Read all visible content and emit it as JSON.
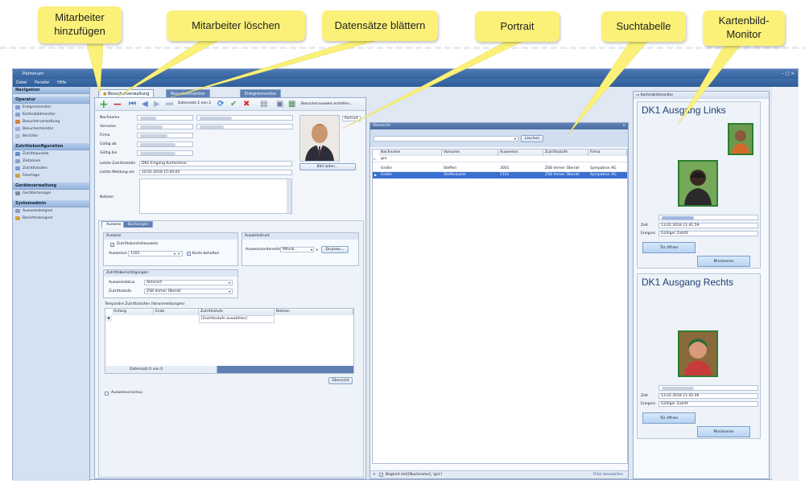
{
  "callouts": {
    "add": "Mitarbeiter hinzufügen",
    "delete": "Mitarbeiter löschen",
    "browse": "Datensätze blättern",
    "portrait": "Portrait",
    "search": "Suchtabelle",
    "monitor": "Kartenbild-Monitor"
  },
  "window": {
    "title": "Patronum",
    "menu": [
      "Datei",
      "Fenster",
      "Hilfe"
    ],
    "controls": "– □ ×"
  },
  "nav": {
    "header": "Navigation",
    "groups": [
      {
        "title": "Operator",
        "items": [
          "Ereignismonitor",
          "Kartenbildmonitor",
          "Besucherverwaltung",
          "Besuchermonitor",
          "Berichte"
        ]
      },
      {
        "title": "Zutrittskonfiguration",
        "items": [
          "Zutrittspunkte",
          "Zeitzonen",
          "Zutrittsstufen",
          "Feiertage"
        ]
      },
      {
        "title": "Geräteverwaltung",
        "items": [
          "Gerätemanager"
        ]
      },
      {
        "title": "Systemadmin",
        "items": [
          "Ausweisdesigner",
          "Berichtsdesigner"
        ]
      }
    ]
  },
  "tabs": [
    "Besucherverwaltung",
    "Besuchermonitor",
    "Ereignismonitor"
  ],
  "toolbar": {
    "record": "Datensatz 2 von 2",
    "print_label": "Besucherausweis erstellen..."
  },
  "form": {
    "labels": [
      "Nachname",
      "Vorname",
      "Firma",
      "Gültig ab",
      "Gültig bis"
    ],
    "last_door_label": "Letzte Zutrittsstelle",
    "last_door_value": "DK2 Eingang Kartenleser",
    "last_msg_label": "Letzte Meldung am",
    "last_msg_value": "10.02.2018 15:04:05",
    "notes_label": "Notizen",
    "load_image": "Bild laden...",
    "portrait_label": "Portrait"
  },
  "lower": {
    "tabs": [
      "Ausweis",
      "Buchungen"
    ],
    "ausweis_title": "Ausweis",
    "checkbox_label": "Zutrittskontrollausweis",
    "ausweis_label": "Ausweisnr.",
    "ausweis_value": "1101",
    "keep_card": "Karte behalten",
    "print_title": "Ausweisdruck",
    "print_label": "Ausweisvorderseite",
    "print_value": "Mitarb...",
    "print_btn": "Drucken...",
    "rights_title": "Zutrittsberechtigungen",
    "status_label": "Ausweisstatus",
    "status_value": "Aktiviert",
    "level_label": "Zutrittsstufe",
    "level_value": "ZSB Immer Überall",
    "temp_title": "Temporäre Zutrittsstufen (Voranmeldungen)",
    "temp_cols": [
      "Anfang",
      "Ende",
      "Zutrittsstufe",
      "Notizen"
    ],
    "temp_row": "[Zutrittsstufe auswählen]",
    "temp_nav": "Datensatz 0 von 0",
    "overview": "Übersicht",
    "preview": "Ausweisvorschau"
  },
  "search": {
    "header": "Übersicht",
    "clear": "Löschen",
    "filter": "gro",
    "columns": [
      "Nachname",
      "Vorname",
      "Ausweisnr.",
      "Zutrittsstufe",
      "Firma"
    ],
    "rows": [
      [
        "Große",
        "Steffen",
        "3001",
        "ZSB Immer Überall",
        "Sympatron AG"
      ],
      [
        "Große",
        "Steffenkarte",
        "1101",
        "ZSB Immer Überall",
        "Sympatron AG"
      ]
    ],
    "footer_filter": "Beginnt mit([Nachname], 'gro')",
    "footer_edit": "Filter bearbeiten"
  },
  "kartenbild": {
    "header": "Kartenbildmonitor",
    "panels": [
      {
        "title": "DK1 Ausgang Links",
        "time_label": "Zeit",
        "time": "13.02.2018 11:41:59",
        "event_label": "Ereignis",
        "event": "Gültiger Zutritt",
        "open": "Tür öffnen",
        "minimize": "Minimieren"
      },
      {
        "title": "DK1 Ausgang Rechts",
        "time_label": "Zeit",
        "time": "13.02.2018 11:42:46",
        "event_label": "Ereignis",
        "event": "Gültiger Zutritt",
        "open": "Tür öffnen",
        "minimize": "Minimieren"
      }
    ]
  },
  "colors": {
    "accent": "#2e5c97",
    "callout": "#fbf178",
    "selection": "#3a6fcf"
  }
}
